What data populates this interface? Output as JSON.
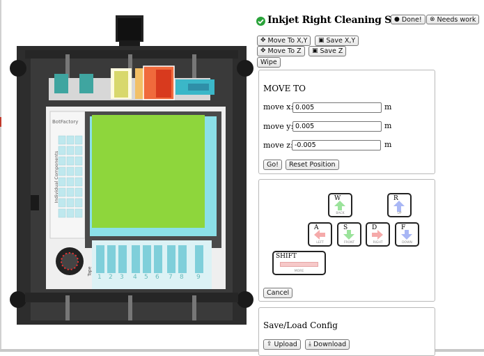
{
  "station": {
    "title": "Inkjet Right Cleaning Station",
    "done_label": "Done!",
    "needs_work_label": "Needs work"
  },
  "controls": {
    "move_to_xy": "Move To X,Y",
    "save_xy": "Save X,Y",
    "move_to_z": "Move To Z",
    "save_z": "Save Z",
    "wipe": "Wipe"
  },
  "move_panel": {
    "heading": "MOVE TO",
    "x_label": "move x:",
    "x_value": "0.005",
    "y_label": "move y:",
    "y_value": "0.005",
    "z_label": "move z:",
    "z_value": "-0.005",
    "unit": "m",
    "go_label": "Go!",
    "reset_label": "Reset Position"
  },
  "jog_panel": {
    "keys": [
      {
        "key": "W",
        "sub": "BACK",
        "color": "#9be39b"
      },
      {
        "key": "R",
        "sub": "UP",
        "color": "#a9b7f5"
      },
      {
        "key": "A",
        "sub": "LEFT",
        "color": "#f5aaaa"
      },
      {
        "key": "S",
        "sub": "FRONT",
        "color": "#9be39b"
      },
      {
        "key": "D",
        "sub": "RIGHT",
        "color": "#f5aaaa"
      },
      {
        "key": "F",
        "sub": "DOWN",
        "color": "#a9b7f5"
      }
    ],
    "shift_key": "SHIFT",
    "shift_sub": "MORE",
    "cancel_label": "Cancel"
  },
  "config_panel": {
    "heading": "Save/Load Config",
    "upload_label": "Upload",
    "download_label": "Download"
  },
  "machine": {
    "brand": "BotFactory",
    "components_label": "Individual Components",
    "tape_label": "Tape",
    "slot_numbers": [
      "1",
      "2",
      "3",
      "4",
      "5",
      "6",
      "7",
      "8",
      "9"
    ],
    "bed_color": "#8ed63c"
  }
}
